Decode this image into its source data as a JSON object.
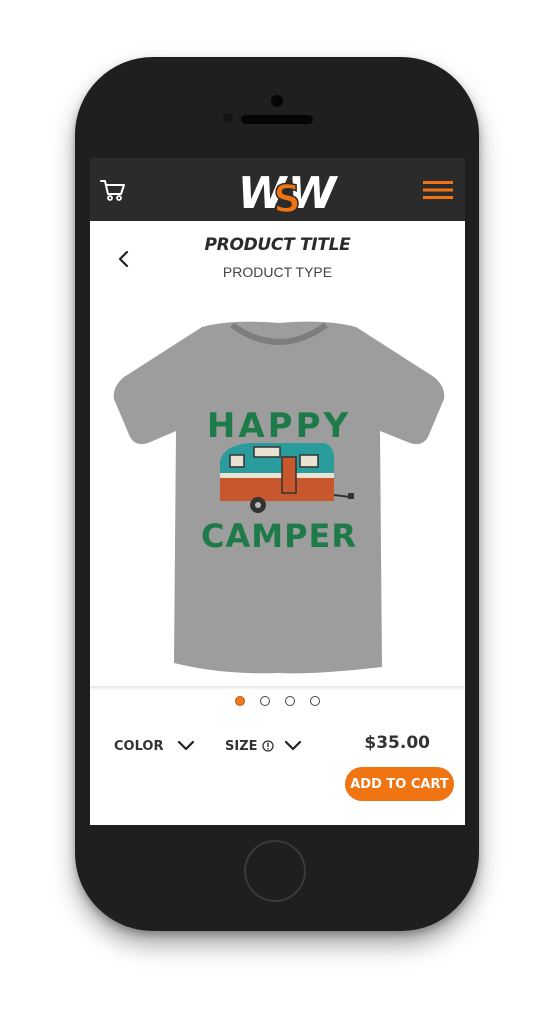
{
  "brand": {
    "logo_text": "WSW",
    "accent_color": "#f07412",
    "navbar_color": "#2b2b2b"
  },
  "navbar": {
    "cart_icon": "cart-icon",
    "menu_icon": "hamburger-menu-icon"
  },
  "product": {
    "title": "PRODUCT TITLE",
    "type": "PRODUCT TYPE",
    "image_text_top": "HAPPY",
    "image_text_bottom": "CAMPER",
    "price": "$35.00"
  },
  "carousel": {
    "total_slides": 4,
    "active_index": 0
  },
  "options": {
    "color_label": "COLOR",
    "size_label": "SIZE"
  },
  "actions": {
    "add_to_cart_label": "ADD TO CART"
  }
}
